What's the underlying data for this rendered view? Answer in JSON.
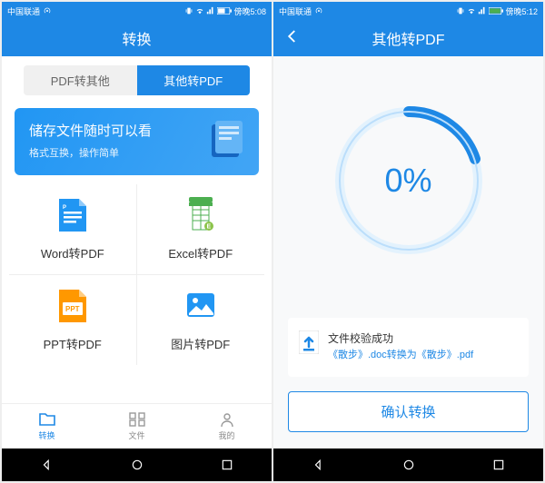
{
  "left": {
    "statusbar": {
      "carrier": "中国联通",
      "time": "傍晚5:08"
    },
    "header": {
      "title": "转换"
    },
    "tabs": {
      "inactive": "PDF转其他",
      "active": "其他转PDF"
    },
    "banner": {
      "title": "储存文件随时可以看",
      "subtitle": "格式互换，操作简单"
    },
    "grid": {
      "word": "Word转PDF",
      "excel": "Excel转PDF",
      "ppt": "PPT转PDF",
      "image": "图片转PDF"
    },
    "nav": {
      "convert": "转换",
      "files": "文件",
      "mine": "我的"
    }
  },
  "right": {
    "statusbar": {
      "carrier": "中国联通",
      "time": "傍晚5:12"
    },
    "header": {
      "title": "其他转PDF"
    },
    "progress": "0%",
    "file": {
      "status": "文件校验成功",
      "detail": "《散步》.doc转换为《散步》.pdf"
    },
    "confirm": "确认转换"
  }
}
